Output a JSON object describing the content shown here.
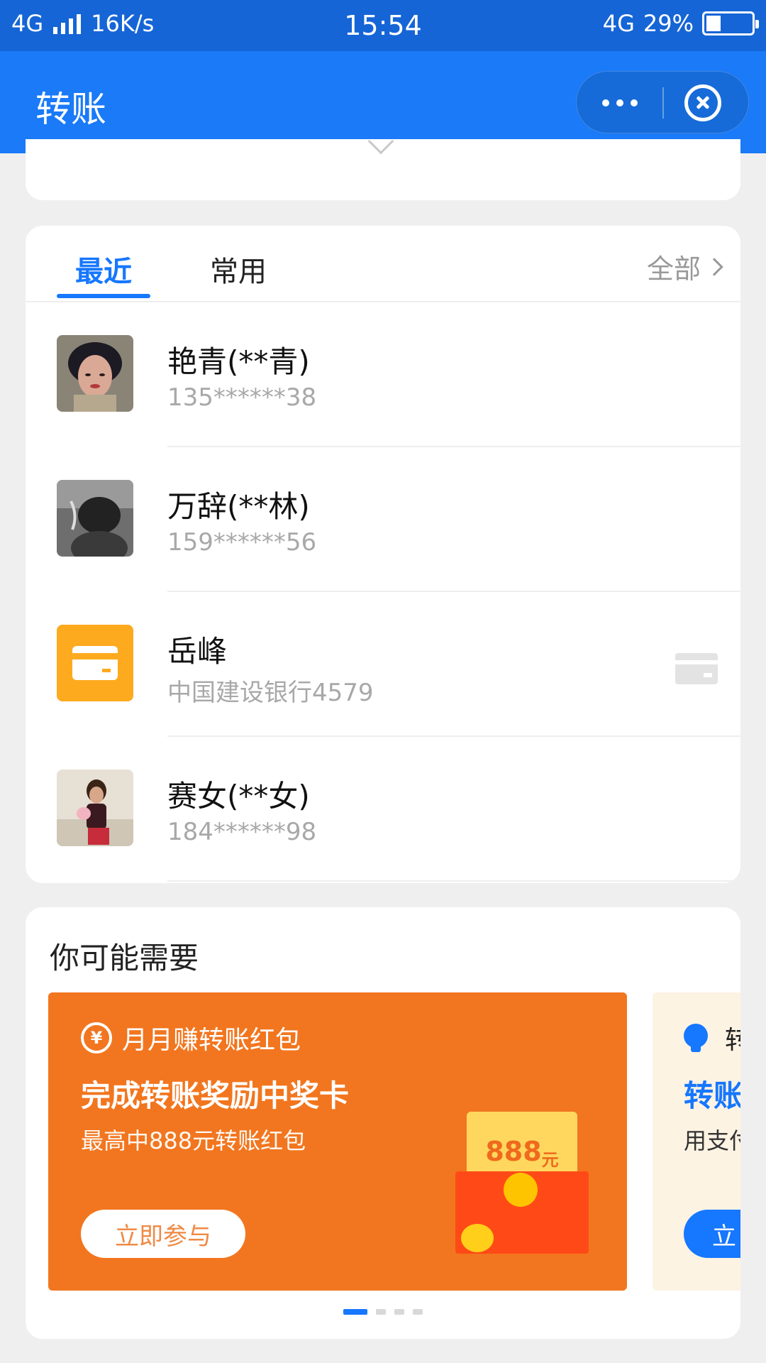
{
  "status_bar": {
    "network": "4G",
    "speed": "16K/s",
    "time": "15:54",
    "network_right": "4G",
    "battery": "29%"
  },
  "nav": {
    "title": "转账"
  },
  "tabs": {
    "recent": "最近",
    "common": "常用",
    "all": "全部"
  },
  "contacts": [
    {
      "name": "艳青(**青)",
      "detail": "135******38",
      "avatar": "photo-avatar"
    },
    {
      "name": "万辞(**林)",
      "detail": "159******56",
      "avatar": "photo-avatar"
    },
    {
      "name": "岳峰",
      "detail": "中国建设银行4579",
      "avatar": "bank-card-icon"
    },
    {
      "name": "赛女(**女)",
      "detail": "184******98",
      "avatar": "photo-avatar"
    }
  ],
  "recommend": {
    "title": "你可能需要",
    "promo1": {
      "brand": "月月赚转账红包",
      "headline": "完成转账奖励中奖卡",
      "subline": "最高中888元转账红包",
      "button": "立即参与",
      "envelope_amount": "888",
      "envelope_unit": "元"
    },
    "promo2": {
      "brand": "转",
      "headline": "转账",
      "subline": "用支付",
      "button": "立"
    }
  },
  "colors": {
    "status_bar": "#1565d6",
    "nav_bar": "#1a7af8",
    "accent": "#1677ff",
    "promo_orange": "#f2761f"
  }
}
